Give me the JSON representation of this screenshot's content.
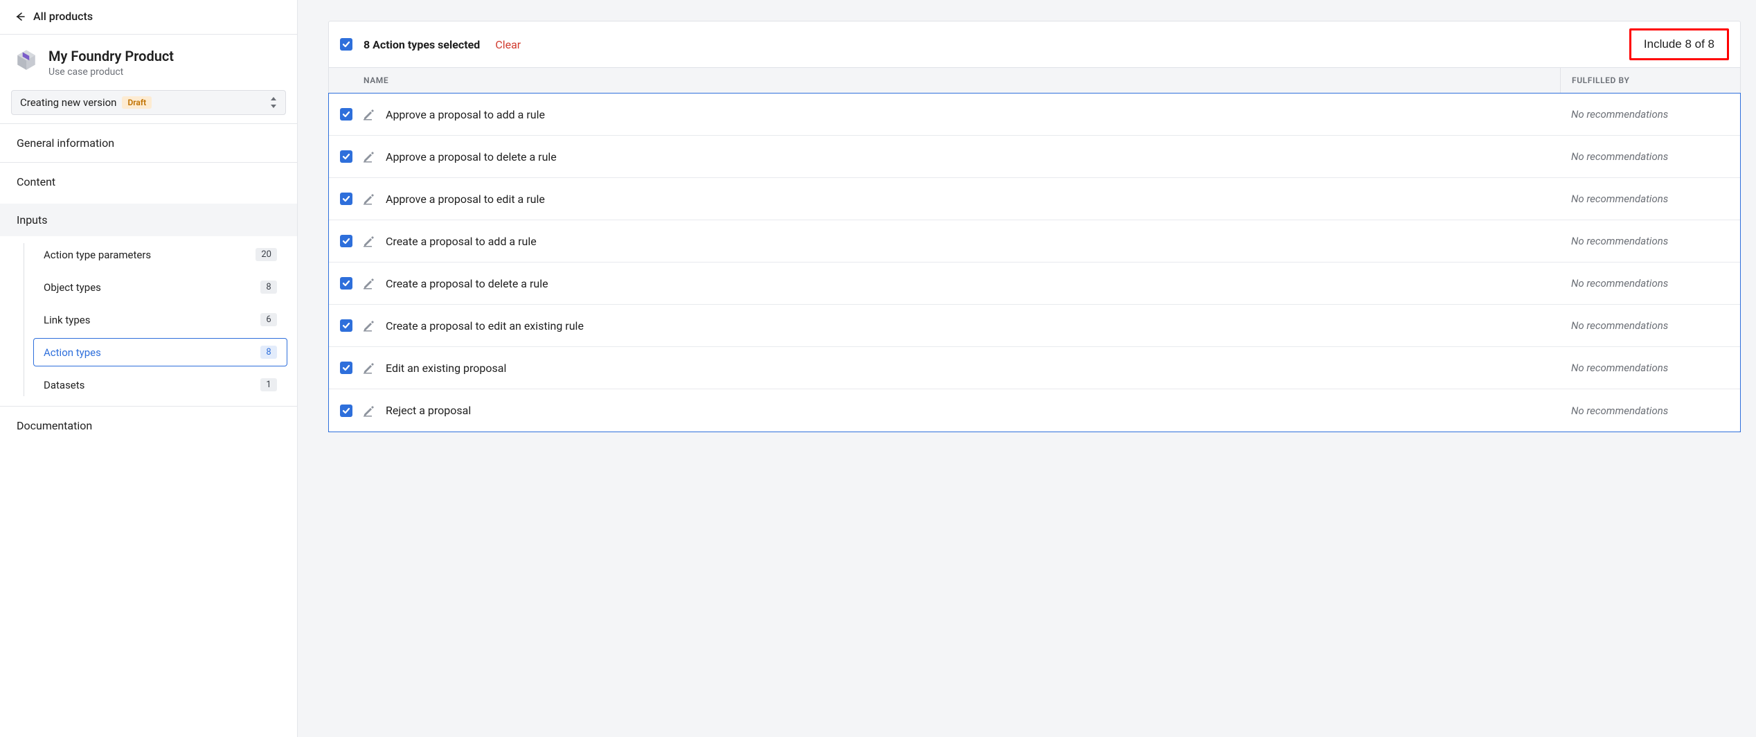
{
  "back": {
    "label": "All products"
  },
  "product": {
    "title": "My Foundry Product",
    "subtitle": "Use case product"
  },
  "version": {
    "label": "Creating new version",
    "badge": "Draft"
  },
  "nav": {
    "general": "General information",
    "content": "Content",
    "inputs": "Inputs",
    "documentation": "Documentation",
    "children": [
      {
        "label": "Action type parameters",
        "count": "20"
      },
      {
        "label": "Object types",
        "count": "8"
      },
      {
        "label": "Link types",
        "count": "6"
      },
      {
        "label": "Action types",
        "count": "8"
      },
      {
        "label": "Datasets",
        "count": "1"
      }
    ]
  },
  "selection": {
    "summary": "8 Action types selected",
    "clear": "Clear",
    "include": "Include 8 of 8"
  },
  "columns": {
    "name": "NAME",
    "fulfilled": "FULFILLED BY"
  },
  "rows": [
    {
      "name": "Approve a proposal to add a rule",
      "fulfilled": "No recommendations"
    },
    {
      "name": "Approve a proposal to delete a rule",
      "fulfilled": "No recommendations"
    },
    {
      "name": "Approve a proposal to edit a rule",
      "fulfilled": "No recommendations"
    },
    {
      "name": "Create a proposal to add a rule",
      "fulfilled": "No recommendations"
    },
    {
      "name": "Create a proposal to delete a rule",
      "fulfilled": "No recommendations"
    },
    {
      "name": "Create a proposal to edit an existing rule",
      "fulfilled": "No recommendations"
    },
    {
      "name": "Edit an existing proposal",
      "fulfilled": "No recommendations"
    },
    {
      "name": "Reject a proposal",
      "fulfilled": "No recommendations"
    }
  ]
}
